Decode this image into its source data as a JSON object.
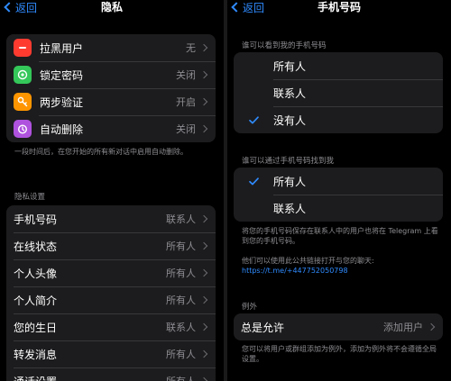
{
  "left": {
    "back_label": "返回",
    "title": "隐私",
    "security_items": [
      {
        "label": "拉黑用户",
        "value": "无",
        "icon": "minus-circle-icon",
        "color": "#ff3b30"
      },
      {
        "label": "锁定密码",
        "value": "关闭",
        "icon": "lock-passcode-icon",
        "color": "#34c759"
      },
      {
        "label": "两步验证",
        "value": "开启",
        "icon": "key-icon",
        "color": "#ff9500"
      },
      {
        "label": "自动删除",
        "value": "关闭",
        "icon": "timer-icon",
        "color": "#af52de"
      }
    ],
    "auto_delete_note": "一段时间后，在您开始的所有新对话中启用自动删除。",
    "privacy_header": "隐私设置",
    "privacy_items": [
      {
        "label": "手机号码",
        "value": "联系人"
      },
      {
        "label": "在线状态",
        "value": "所有人"
      },
      {
        "label": "个人头像",
        "value": "所有人"
      },
      {
        "label": "个人简介",
        "value": "所有人"
      },
      {
        "label": "您的生日",
        "value": "联系人"
      },
      {
        "label": "转发消息",
        "value": "所有人"
      },
      {
        "label": "通话设置",
        "value": "所有人"
      }
    ]
  },
  "right": {
    "back_label": "返回",
    "title": "手机号码",
    "who_can_see_header": "谁可以看到我的手机号码",
    "who_can_see_options": [
      {
        "label": "所有人",
        "selected": false
      },
      {
        "label": "联系人",
        "selected": false
      },
      {
        "label": "没有人",
        "selected": true
      }
    ],
    "find_by_number_header": "谁可以通过手机号码找到我",
    "find_by_number_options": [
      {
        "label": "所有人",
        "selected": true
      },
      {
        "label": "联系人",
        "selected": false
      }
    ],
    "find_note": "将您的手机号码保存在联系人中的用户也将在 Telegram 上看到您的手机号码。",
    "public_link_note": "他们可以使用此公共链接打开与您的聊天:",
    "public_link": "https://t.me/+447752050798",
    "exceptions_header": "例外",
    "always_allow_label": "总是允许",
    "always_allow_value": "添加用户",
    "exceptions_note": "您可以将用户或群组添加为例外，添加为例外将不会遵循全局设置。"
  },
  "colors": {
    "accent": "#2f8bff",
    "background": "#000000",
    "cell": "#1c1c1e",
    "secondary_text": "#8e8e93"
  }
}
